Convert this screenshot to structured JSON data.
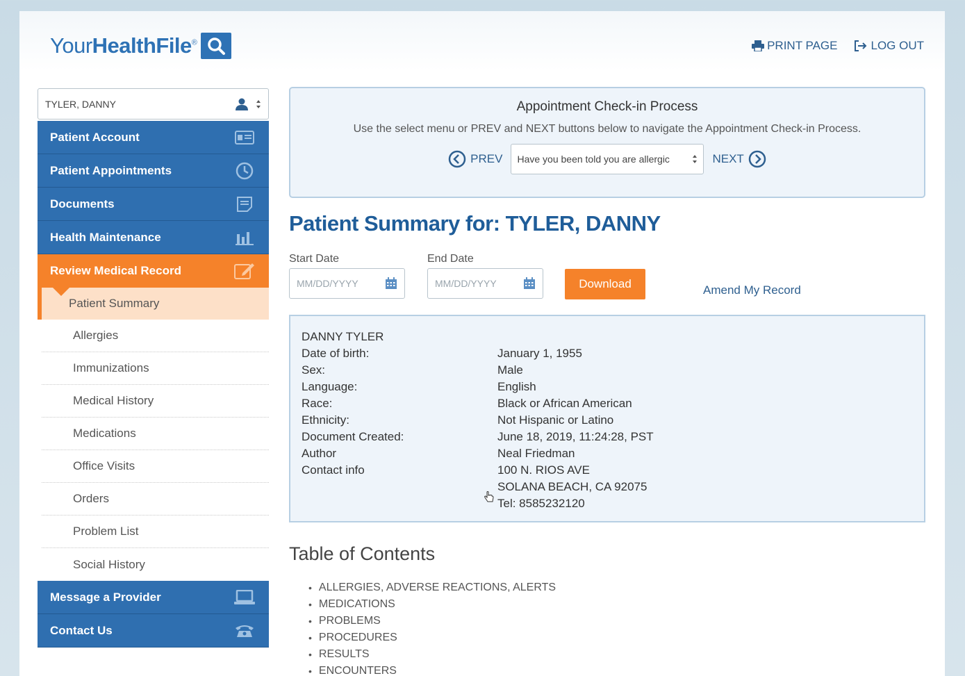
{
  "header": {
    "logo_part1": "Your",
    "logo_part2": "HealthFile",
    "logo_reg": "®",
    "print_label": "PRINT PAGE",
    "logout_label": "LOG OUT"
  },
  "sidebar": {
    "patient_name": "TYLER, DANNY",
    "items_top": [
      {
        "label": "Patient Account",
        "icon": "id-card-icon"
      },
      {
        "label": "Patient Appointments",
        "icon": "clock-icon"
      },
      {
        "label": "Documents",
        "icon": "document-icon"
      },
      {
        "label": "Health Maintenance",
        "icon": "bar-chart-icon"
      }
    ],
    "active_section": {
      "label": "Review Medical Record",
      "icon": "edit-icon"
    },
    "active_sub": "Patient Summary",
    "sub_items": [
      "Allergies",
      "Immunizations",
      "Medical History",
      "Medications",
      "Office Visits",
      "Orders",
      "Problem List",
      "Social History"
    ],
    "items_bottom": [
      {
        "label": "Message a Provider",
        "icon": "laptop-icon"
      },
      {
        "label": "Contact Us",
        "icon": "phone-icon"
      }
    ]
  },
  "checkin": {
    "title": "Appointment Check-in Process",
    "description": "Use the select menu or PREV and NEXT buttons below to navigate the Appointment Check-in Process.",
    "prev_label": "PREV",
    "next_label": "NEXT",
    "selected_step": "Have you been told you are allergic"
  },
  "summary": {
    "title": "Patient Summary for: TYLER, DANNY",
    "start_date_label": "Start Date",
    "end_date_label": "End Date",
    "date_placeholder": "MM/DD/YYYY",
    "download_label": "Download",
    "amend_label": "Amend My Record"
  },
  "patient_info": {
    "name": "DANNY TYLER",
    "rows": [
      {
        "key": "Date of birth:",
        "value": "January 1, 1955"
      },
      {
        "key": "Sex:",
        "value": "Male"
      },
      {
        "key": "Language:",
        "value": "English"
      },
      {
        "key": "Race:",
        "value": "Black or African American"
      },
      {
        "key": "Ethnicity:",
        "value": "Not Hispanic or Latino"
      },
      {
        "key": "Document Created:",
        "value": "June 18, 2019, 11:24:28, PST"
      },
      {
        "key": "Author",
        "value": "Neal Friedman"
      },
      {
        "key": "Contact info",
        "value": "100 N. RIOS AVE"
      },
      {
        "key": "",
        "value": "SOLANA BEACH, CA 92075"
      },
      {
        "key": "",
        "value": "Tel: 8585232120"
      }
    ]
  },
  "toc": {
    "title": "Table of Contents",
    "items": [
      "ALLERGIES, ADVERSE REACTIONS, ALERTS",
      "MEDICATIONS",
      "PROBLEMS",
      "PROCEDURES",
      "RESULTS",
      "ENCOUNTERS"
    ]
  }
}
